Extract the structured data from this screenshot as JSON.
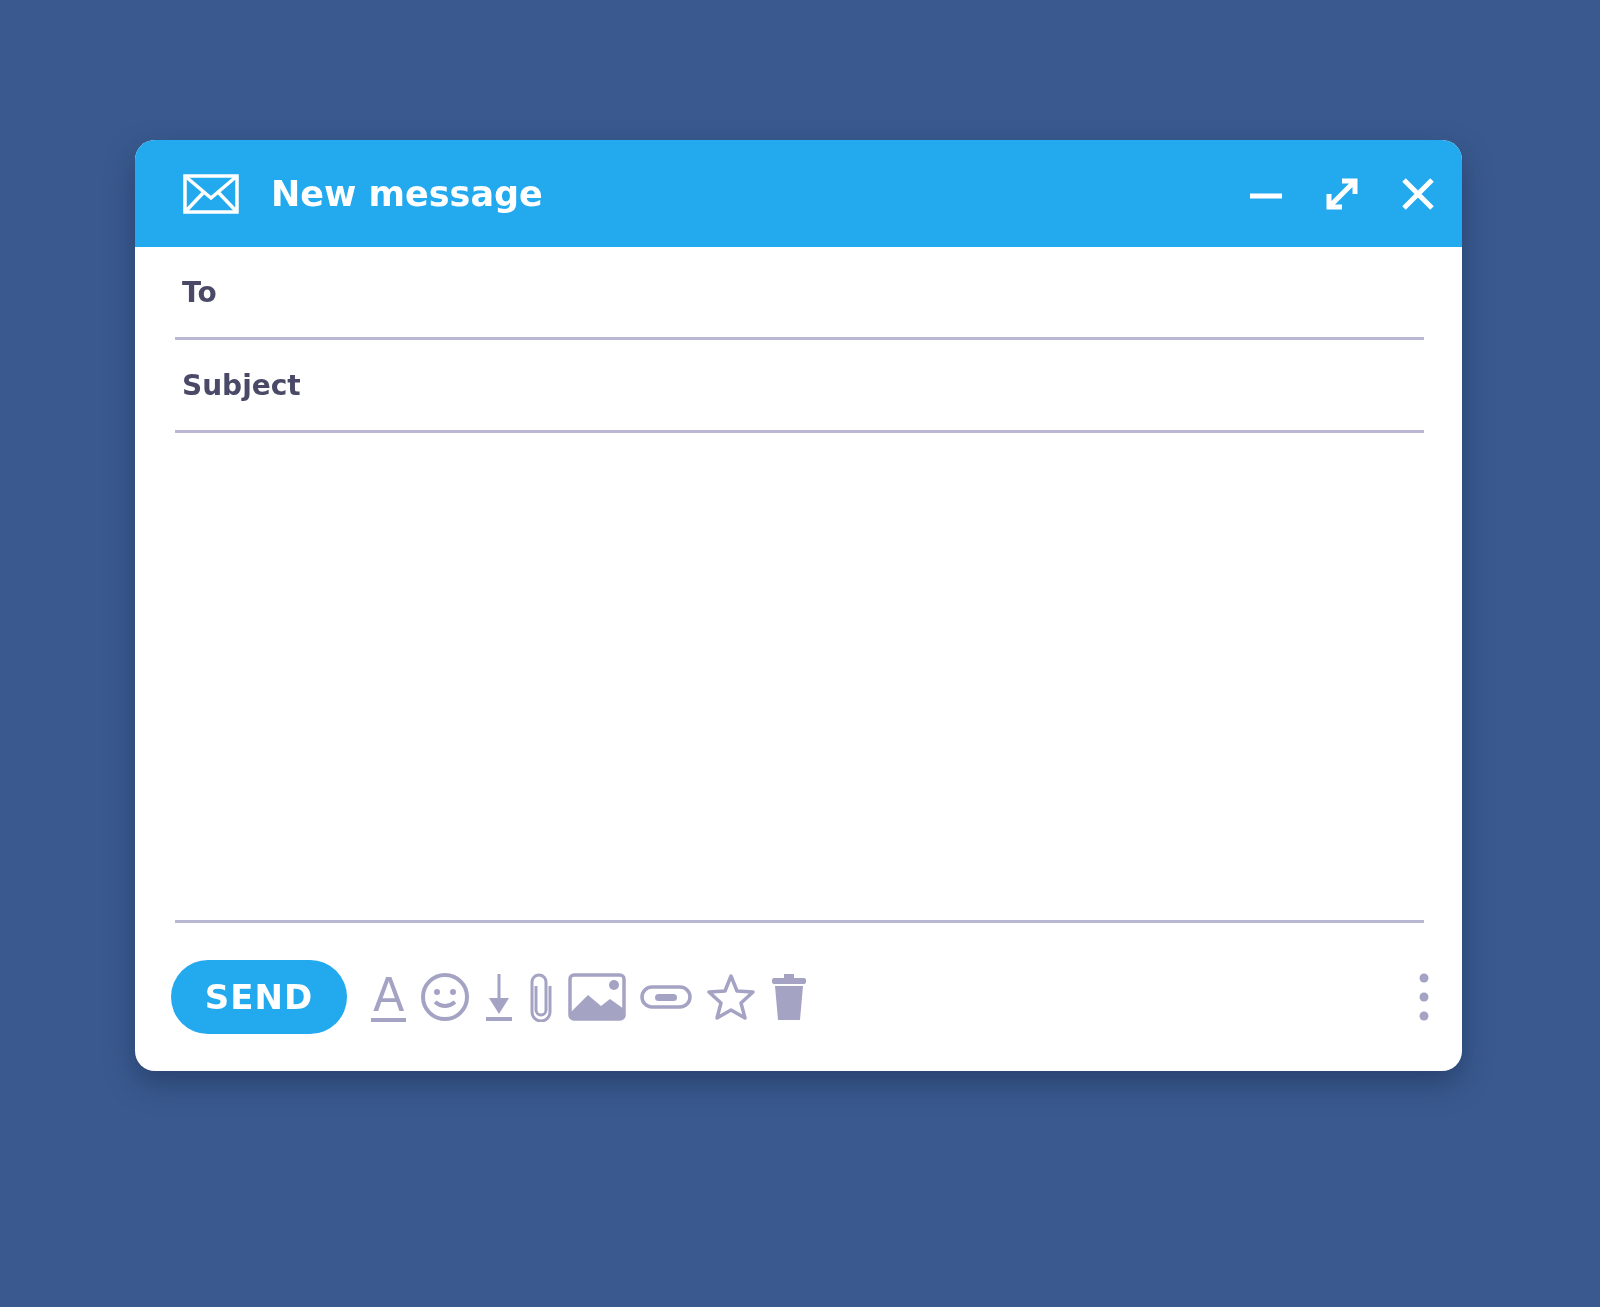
{
  "window": {
    "title": "New message"
  },
  "fields": [
    {
      "label": "To"
    },
    {
      "label": "Subject"
    }
  ],
  "toolbar": {
    "send_label": "SEND",
    "format_glyph": "A"
  }
}
